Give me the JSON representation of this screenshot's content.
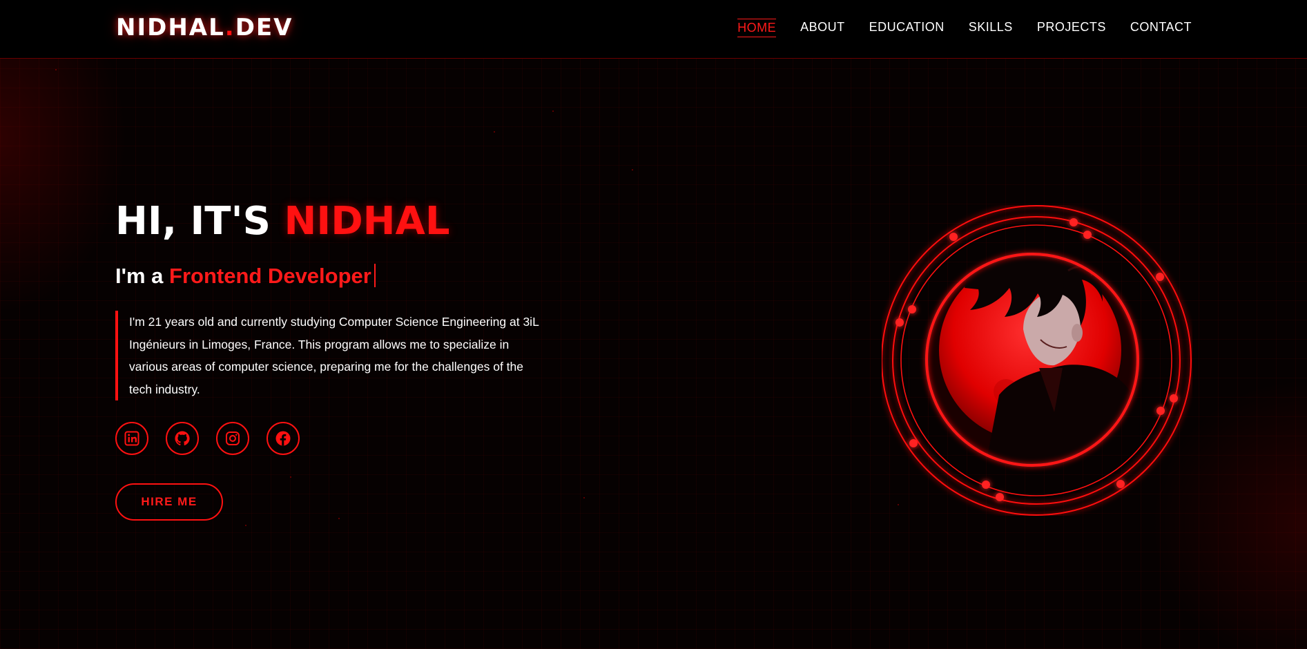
{
  "header": {
    "logo_main": "NIDHAL",
    "logo_dot": ".",
    "logo_tld": "DEV",
    "nav": [
      {
        "label": "HOME",
        "active": true
      },
      {
        "label": "ABOUT",
        "active": false
      },
      {
        "label": "EDUCATION",
        "active": false
      },
      {
        "label": "SKILLS",
        "active": false
      },
      {
        "label": "PROJECTS",
        "active": false
      },
      {
        "label": "CONTACT",
        "active": false
      }
    ]
  },
  "hero": {
    "greeting": "HI, IT'S ",
    "name": "NIDHAL",
    "sub_prefix": "I'm a ",
    "role": "Frontend Developer",
    "description": "I'm 21 years old and currently studying Computer Science Engineering at 3iL Ingénieurs in Limoges, France. This program allows me to specialize in various areas of computer science, preparing me for the challenges of the tech industry.",
    "socials": [
      {
        "icon": "linkedin-icon"
      },
      {
        "icon": "github-icon"
      },
      {
        "icon": "instagram-icon"
      },
      {
        "icon": "facebook-icon"
      }
    ],
    "cta_label": "HIRE ME"
  },
  "colors": {
    "accent": "#ff1111",
    "background": "#070202",
    "navbar": "#000000",
    "text": "#ffffff"
  }
}
